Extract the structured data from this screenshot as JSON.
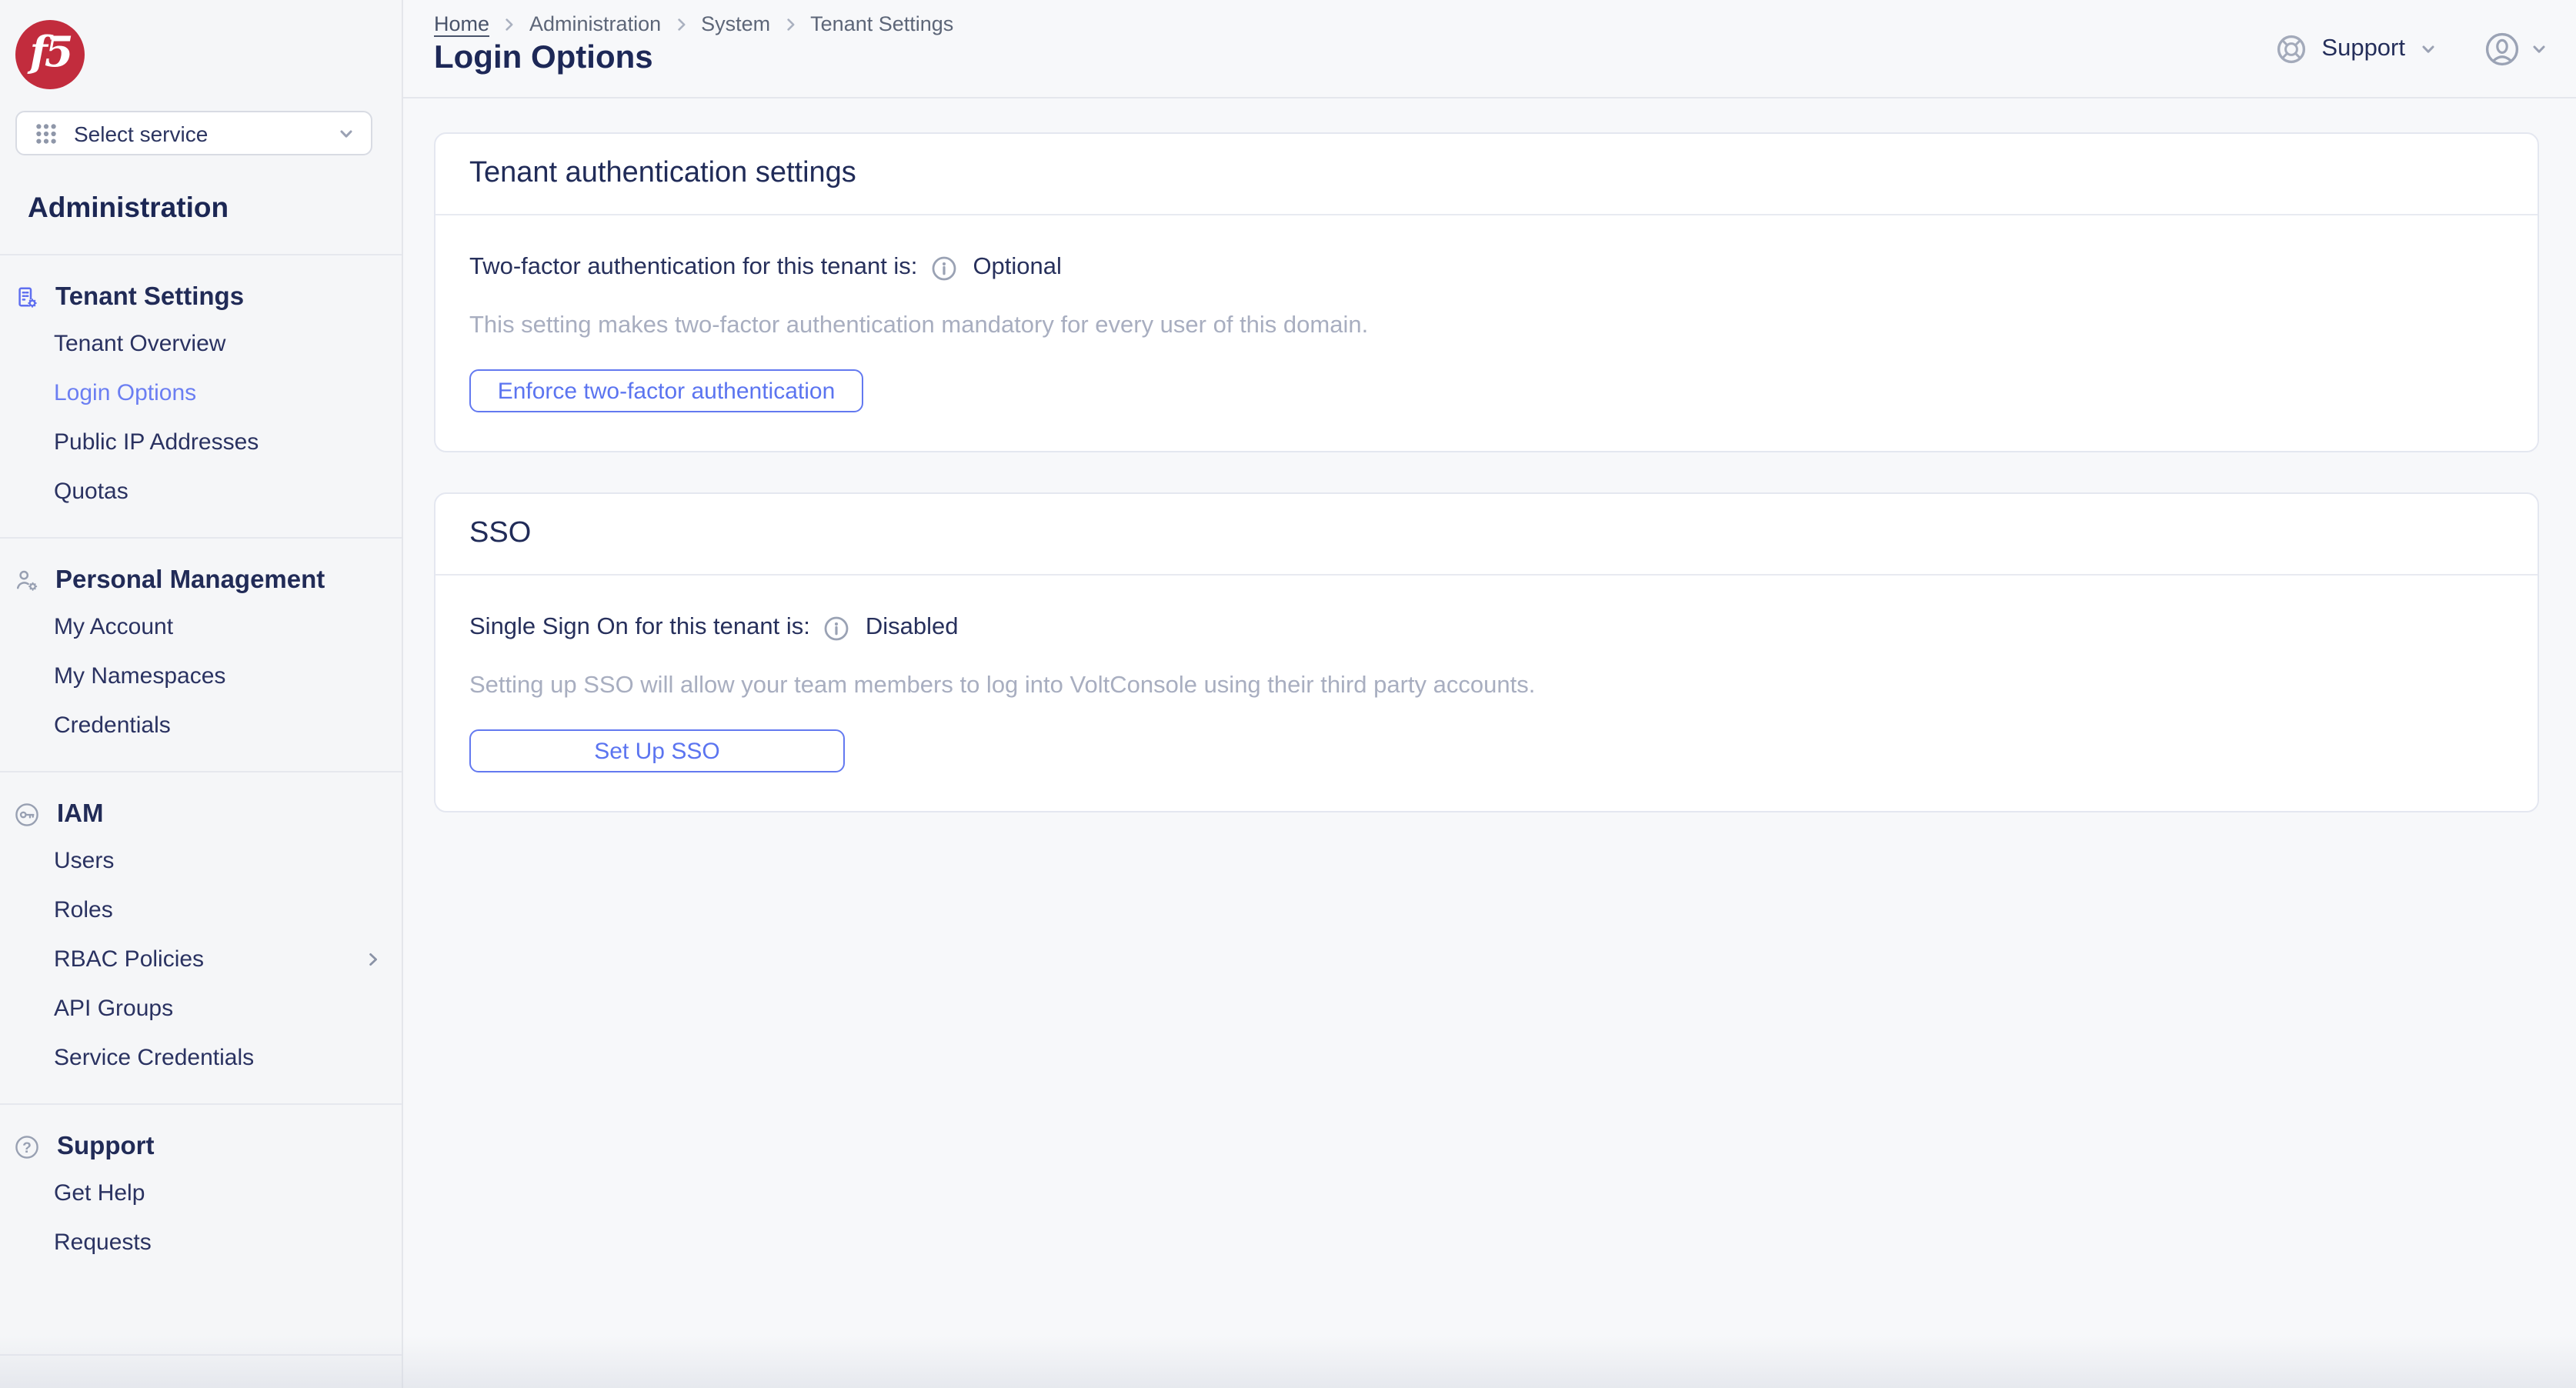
{
  "brand": {
    "logo_text": "f5"
  },
  "service_picker": {
    "label": "Select service"
  },
  "sidebar": {
    "title": "Administration",
    "sections": [
      {
        "label": "Tenant Settings",
        "icon": "building-gear-icon",
        "items": [
          {
            "label": "Tenant Overview"
          },
          {
            "label": "Login Options",
            "active": true
          },
          {
            "label": "Public IP Addresses"
          },
          {
            "label": "Quotas"
          }
        ]
      },
      {
        "label": "Personal Management",
        "icon": "user-gear-icon",
        "items": [
          {
            "label": "My Account"
          },
          {
            "label": "My Namespaces"
          },
          {
            "label": "Credentials"
          }
        ]
      },
      {
        "label": "IAM",
        "icon": "key-icon",
        "items": [
          {
            "label": "Users"
          },
          {
            "label": "Roles"
          },
          {
            "label": "RBAC Policies",
            "has_submenu": true
          },
          {
            "label": "API Groups"
          },
          {
            "label": "Service Credentials"
          }
        ]
      },
      {
        "label": "Support",
        "icon": "question-icon",
        "items": [
          {
            "label": "Get Help"
          },
          {
            "label": "Requests"
          }
        ]
      }
    ]
  },
  "header": {
    "breadcrumb": [
      {
        "label": "Home"
      },
      {
        "label": "Administration"
      },
      {
        "label": "System"
      },
      {
        "label": "Tenant Settings"
      }
    ],
    "page_title": "Login Options",
    "support_label": "Support"
  },
  "cards": [
    {
      "title": "Tenant authentication settings",
      "status_label": "Two-factor authentication for this tenant is:",
      "status_value": "Optional",
      "description": "This setting makes two-factor authentication mandatory for every user of this domain.",
      "button_label": "Enforce two-factor authentication"
    },
    {
      "title": "SSO",
      "status_label": "Single Sign On for this tenant is:",
      "status_value": "Disabled",
      "description": "Setting up SSO will allow your team members to log into VoltConsole using their third party accounts.",
      "button_label": "Set Up SSO"
    }
  ],
  "colors": {
    "brand_red": "#c22c3d",
    "accent_blue": "#5b72ee",
    "active_link_blue": "#6b7ef2",
    "heading_navy": "#1e2957",
    "muted_text": "#a8aec0",
    "icon_gray": "#98a0b2",
    "sidebar_bg": "#f5f6f8",
    "page_bg": "#f7f8fa"
  }
}
